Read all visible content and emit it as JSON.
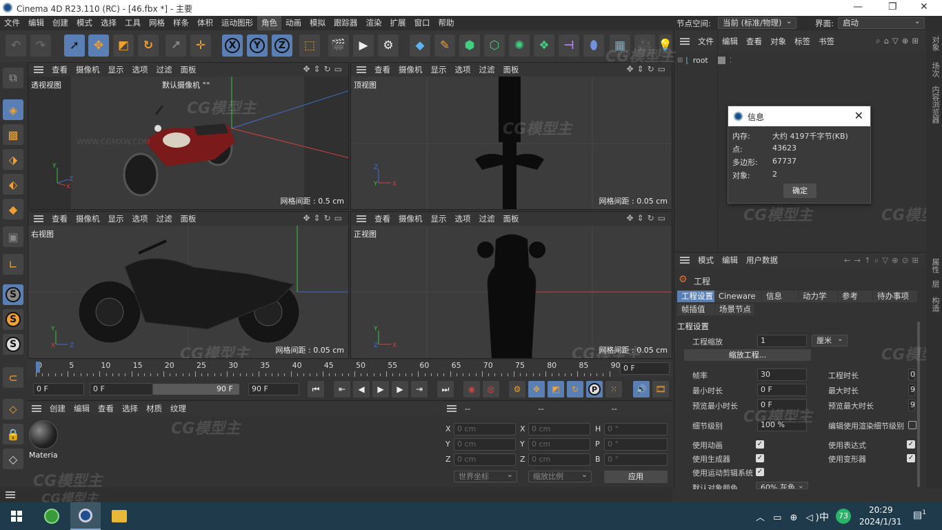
{
  "window": {
    "title": "Cinema 4D R23.110 (RC) - [46.fbx *] - 主要",
    "controls": [
      "—",
      "❐",
      "✕"
    ]
  },
  "menu": [
    "文件",
    "编辑",
    "创建",
    "模式",
    "选择",
    "工具",
    "网格",
    "样条",
    "体积",
    "运动图形",
    "角色",
    "动画",
    "模拟",
    "跟踪器",
    "渲染",
    "扩展",
    "窗口",
    "帮助"
  ],
  "menu_highlighted": "角色",
  "node_space": {
    "label": "节点空间:",
    "value": "当前 (标准/物理)"
  },
  "interface": {
    "label": "界面:",
    "value": "启动"
  },
  "viewport_menu": [
    "查看",
    "摄像机",
    "显示",
    "选项",
    "过滤",
    "面板"
  ],
  "viewports": {
    "perspective": {
      "label": "透视视图",
      "camera": "默认摄像机 °°",
      "grid": "网格间距 : 0.5 cm"
    },
    "top": {
      "label": "顶视图",
      "grid": "网格间距 : 0.05 cm"
    },
    "right": {
      "label": "右视图",
      "grid": "网格间距 : 0.05 cm"
    },
    "front": {
      "label": "正视图",
      "grid": "网格间距 : 0.05 cm"
    }
  },
  "axes": {
    "x": "X",
    "y": "Y",
    "z": "Z"
  },
  "timeline": {
    "ticks": [
      "0",
      "5",
      "10",
      "15",
      "20",
      "25",
      "30",
      "35",
      "40",
      "45",
      "50",
      "55",
      "60",
      "65",
      "70",
      "75",
      "80",
      "85",
      "90"
    ],
    "current_frame": "0 F",
    "start": "0 F",
    "range_start": "0 F",
    "range_end": "90 F",
    "end": "90 F"
  },
  "material_panel": {
    "menu": [
      "创建",
      "编辑",
      "查看",
      "选择",
      "材质",
      "纹理"
    ],
    "material_name": "Materia"
  },
  "coord_panel": {
    "header": [
      "--",
      "--",
      "--"
    ],
    "rows": [
      {
        "a": "X",
        "av": "0 cm",
        "b": "X",
        "bv": "0 cm",
        "c": "H",
        "cv": "0 °"
      },
      {
        "a": "Y",
        "av": "0 cm",
        "b": "Y",
        "bv": "0 cm",
        "c": "P",
        "cv": "0 °"
      },
      {
        "a": "Z",
        "av": "0 cm",
        "b": "Z",
        "bv": "0 cm",
        "c": "B",
        "cv": "0 °"
      }
    ],
    "world": "世界坐标",
    "scale": "缩放比例",
    "apply": "应用"
  },
  "object_manager": {
    "menu": [
      "文件",
      "编辑",
      "查看",
      "对象",
      "标签",
      "书签"
    ],
    "root": "root"
  },
  "info_dialog": {
    "title": "信息",
    "rows": [
      {
        "k": "内存:",
        "v": "大约 4197千字节(KB)"
      },
      {
        "k": "点:",
        "v": "43623"
      },
      {
        "k": "多边形:",
        "v": "67737"
      },
      {
        "k": "对象:",
        "v": "2"
      }
    ],
    "ok": "确定"
  },
  "attributes": {
    "menu": [
      "模式",
      "编辑",
      "用户数据"
    ],
    "object": "工程",
    "tabs": [
      "工程设置",
      "Cineware",
      "信息",
      "动力学",
      "参考",
      "待办事项"
    ],
    "tabs2": [
      "帧插值",
      "场景节点"
    ],
    "section": "工程设置",
    "scale_label": "工程缩放",
    "scale_value": "1",
    "scale_unit": "厘米",
    "scale_btn": "缩放工程...",
    "fps_label": "帧率",
    "fps": "30",
    "proj_time_label": "工程时长",
    "proj_time": "0",
    "min_time_label": "最小时长",
    "min_time": "0 F",
    "max_time_label": "最大时长",
    "max_time": "9",
    "prev_min_label": "预览最小时长",
    "prev_min": "0 F",
    "prev_max_label": "预览最大时长",
    "prev_max": "9",
    "lod_label": "细节级别",
    "lod": "100 %",
    "lod_render_label": "编辑使用渲染细节级别",
    "use_anim": "使用动画",
    "use_expr": "使用表达式",
    "use_gen": "使用生成器",
    "use_deform": "使用变形器",
    "use_motion": "使用运动剪辑系统",
    "default_color_label": "默认对象颜色",
    "default_color": "60% 灰色"
  },
  "right_strip": [
    "对象",
    "场次",
    "内容浏览器",
    "属性",
    "层",
    "构造"
  ],
  "taskbar": {
    "badge": "73",
    "ime": "中",
    "time": "20:29",
    "date": "2024/1/31",
    "notify": "1"
  },
  "watermark": {
    "logo": "CG模型主",
    "url": "WWW.CGMXW.COM"
  },
  "colors": {
    "accent": "#5a7fb5",
    "axis_x": "#d04040",
    "axis_y": "#40c040",
    "axis_z": "#4070d0"
  }
}
